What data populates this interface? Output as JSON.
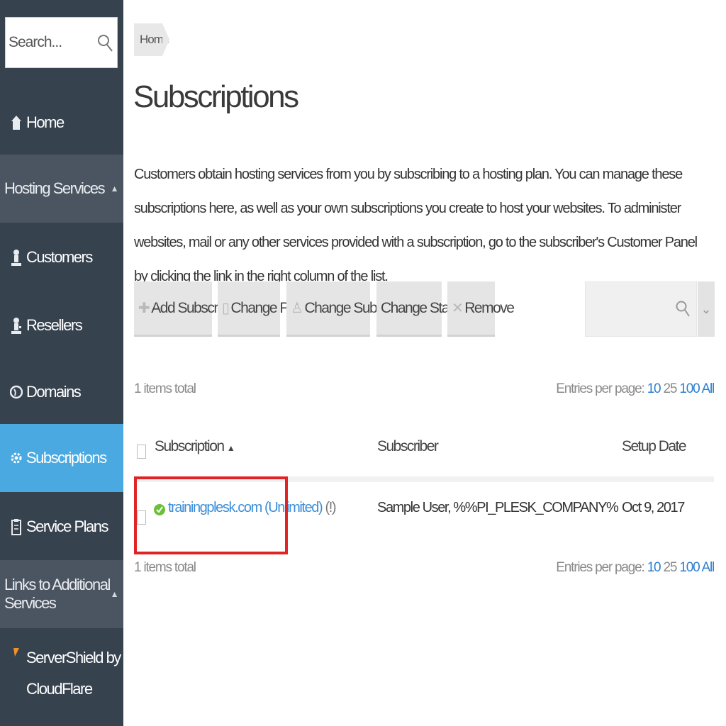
{
  "search": {
    "placeholder": "Search..."
  },
  "sidebar": {
    "home": "Home",
    "hosting_section": "Hosting Services",
    "items": [
      {
        "label": "Customers",
        "icon": "person-icon"
      },
      {
        "label": "Resellers",
        "icon": "reseller-icon"
      },
      {
        "label": "Domains",
        "icon": "globe-icon"
      },
      {
        "label": "Subscriptions",
        "icon": "gear-icon"
      },
      {
        "label": "Service Plans",
        "icon": "clipboard-icon"
      }
    ],
    "links_section": "Links to Additional Services",
    "servershield_line1": "ServerShield by",
    "servershield_line2": "CloudFlare"
  },
  "breadcrumb": {
    "home": "Home"
  },
  "page": {
    "title": "Subscriptions",
    "description": "Customers obtain hosting services from you by subscribing to a hosting plan. You can manage these subscriptions here, as well as your own subscriptions you create to host your websites. To administer websites, mail or any other services provided with a subscription, go to the subscriber's Customer Panel by clicking the link in the right column of the list."
  },
  "toolbar": {
    "add": "Add Subscription",
    "change_plan": "Change Plan",
    "change_subscriber": "Change Subscriber",
    "change_status": "Change Status",
    "remove": "Remove"
  },
  "list": {
    "total_top": "1 items total",
    "total_bottom": "1 items total",
    "entries_label": "Entries per page:",
    "entries_options": [
      "10",
      "25",
      "100",
      "All"
    ],
    "columns": {
      "subscription": "Subscription",
      "subscriber": "Subscriber",
      "setup_date": "Setup Date"
    },
    "rows": [
      {
        "domain": "trainingplesk.com",
        "plan": "(Unlimited)",
        "info": "(!)",
        "subscriber": "Sample User, %%PI_PLESK_COMPANY%",
        "setup_date": "Oct 9, 2017"
      }
    ]
  },
  "colors": {
    "sidebar_bg": "#37424f",
    "section_bg": "#4b5562",
    "active_bg": "#49a9e0",
    "link": "#3c8ed8",
    "highlight": "#e02424",
    "status_ok": "#6cbf3a"
  }
}
